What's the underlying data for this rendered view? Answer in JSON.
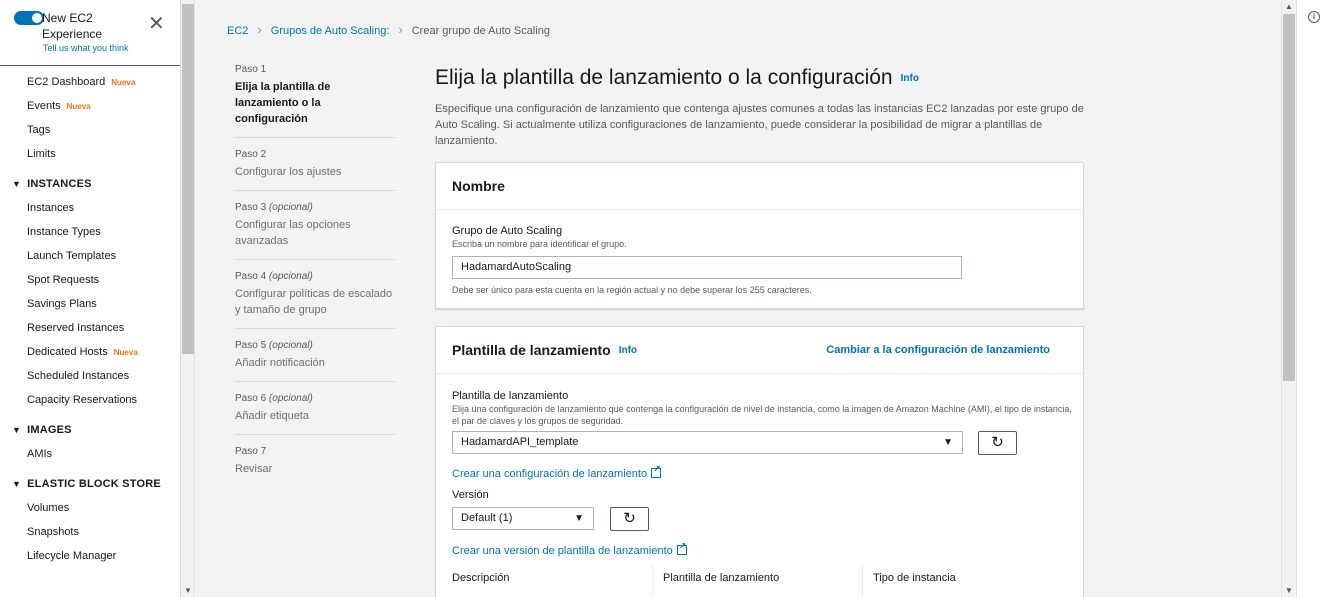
{
  "sidebar": {
    "toggle_label": "New EC2 Experience",
    "toggle_sub": "Tell us what you think",
    "items": [
      {
        "label": "EC2 Dashboard",
        "badge": "Nueva"
      },
      {
        "label": "Events",
        "badge": "Nueva"
      },
      {
        "label": "Tags",
        "badge": ""
      },
      {
        "label": "Limits",
        "badge": ""
      }
    ],
    "sections": [
      {
        "title": "INSTANCES",
        "items": [
          {
            "label": "Instances",
            "badge": ""
          },
          {
            "label": "Instance Types",
            "badge": ""
          },
          {
            "label": "Launch Templates",
            "badge": ""
          },
          {
            "label": "Spot Requests",
            "badge": ""
          },
          {
            "label": "Savings Plans",
            "badge": ""
          },
          {
            "label": "Reserved Instances",
            "badge": ""
          },
          {
            "label": "Dedicated Hosts",
            "badge": "Nueva"
          },
          {
            "label": "Scheduled Instances",
            "badge": ""
          },
          {
            "label": "Capacity Reservations",
            "badge": ""
          }
        ]
      },
      {
        "title": "IMAGES",
        "items": [
          {
            "label": "AMIs",
            "badge": ""
          }
        ]
      },
      {
        "title": "ELASTIC BLOCK STORE",
        "items": [
          {
            "label": "Volumes",
            "badge": ""
          },
          {
            "label": "Snapshots",
            "badge": ""
          },
          {
            "label": "Lifecycle Manager",
            "badge": ""
          }
        ]
      }
    ]
  },
  "breadcrumb": {
    "items": [
      "EC2",
      "Grupos de Auto Scaling:",
      "Crear grupo de Auto Scaling"
    ]
  },
  "steps": [
    {
      "num": "Paso 1",
      "optional": "",
      "title": "Elija la plantilla de lanzamiento o la configuración",
      "active": true
    },
    {
      "num": "Paso 2",
      "optional": "",
      "title": "Configurar los ajustes",
      "active": false
    },
    {
      "num": "Paso 3",
      "optional": "(opcional)",
      "title": "Configurar las opciones avanzadas",
      "active": false
    },
    {
      "num": "Paso 4",
      "optional": "(opcional)",
      "title": "Configurar políticas de escalado y tamaño de grupo",
      "active": false
    },
    {
      "num": "Paso 5",
      "optional": "(opcional)",
      "title": "Añadir notificación",
      "active": false
    },
    {
      "num": "Paso 6",
      "optional": "(opcional)",
      "title": "Añadir etiqueta",
      "active": false
    },
    {
      "num": "Paso 7",
      "optional": "",
      "title": "Revisar",
      "active": false
    }
  ],
  "main": {
    "title": "Elija la plantilla de lanzamiento o la configuración",
    "info": "Info",
    "description": "Especifique una configuración de lanzamiento que contenga ajustes comunes a todas las instancias EC2 lanzadas por este grupo de Auto Scaling. Si actualmente utiliza configuraciones de lanzamiento, puede considerar la posibilidad de migrar a plantillas de lanzamiento."
  },
  "name_panel": {
    "header": "Nombre",
    "label": "Grupo de Auto Scaling",
    "help": "Escriba un nombre para identificar el grupo.",
    "value": "HadamardAutoScaling",
    "hint": "Debe ser único para esta cuenta en la región actual y no debe superar los 255 caracteres."
  },
  "template_panel": {
    "header": "Plantilla de lanzamiento",
    "info": "Info",
    "switch_link": "Cambiar a la configuración de lanzamiento",
    "label": "Plantilla de lanzamiento",
    "help": "Elija una configuración de lanzamiento que contenga la configuración de nivel de instancia, como la imagen de Amazon Machine (AMI), el tipo de instancia, el par de claves y los grupos de seguridad.",
    "selected": "HadamardAPI_template",
    "create_link": "Crear una configuración de lanzamiento",
    "version_label": "Versión",
    "version_selected": "Default (1)",
    "create_version_link": "Crear una versión de plantilla de lanzamiento",
    "columns": [
      "Descripción",
      "Plantilla de lanzamiento",
      "Tipo de instancia"
    ]
  }
}
